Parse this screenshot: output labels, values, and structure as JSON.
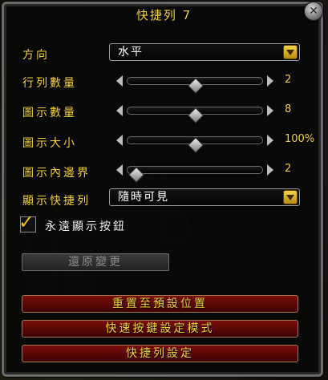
{
  "window": {
    "title": "快捷列 7",
    "close_label": "✕"
  },
  "settings": {
    "orientation": {
      "label": "方向",
      "value": "水平"
    },
    "rows": {
      "label": "行列數量",
      "value": "2",
      "level": 0.5
    },
    "icon_count": {
      "label": "圖示數量",
      "value": "8",
      "level": 0.5
    },
    "icon_size": {
      "label": "圖示大小",
      "value": "100%",
      "level": 0.5
    },
    "icon_padding": {
      "label": "圖示內邊界",
      "value": "2",
      "level": 0.0
    },
    "visibility": {
      "label": "顯示快捷列",
      "value": "隨時可見"
    },
    "always_show_buttons": {
      "label": "永遠顯示按鈕",
      "checked": true
    }
  },
  "buttons": {
    "revert": "還原變更",
    "reset_default_position": "重置至預設位置",
    "quick_keybind_mode": "快速按鍵設定模式",
    "actionbar_settings": "快捷列設定"
  },
  "colors": {
    "accent_gold": "#f5d23c",
    "button_red": "#7a0d0a"
  }
}
